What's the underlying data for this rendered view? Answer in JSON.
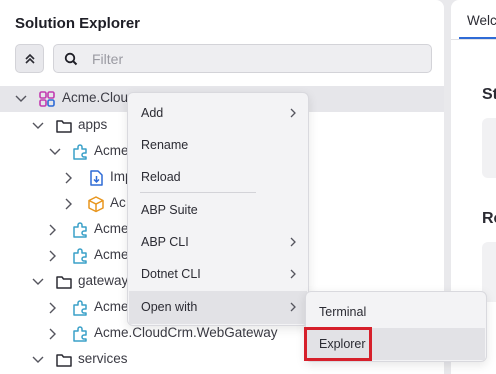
{
  "solution_explorer": {
    "title": "Solution Explorer",
    "filter_placeholder": "Filter",
    "tree": [
      {
        "label": "Acme.Clou",
        "icon": "solution-icon",
        "expanded": true
      },
      {
        "label": "apps",
        "icon": "folder-icon",
        "expanded": true
      },
      {
        "label": "Acme",
        "icon": "module-icon",
        "expanded": true
      },
      {
        "label": "Imp",
        "icon": "import-icon",
        "expanded": false
      },
      {
        "label": "Ac",
        "icon": "package-icon",
        "expanded": false
      },
      {
        "label": "Acme",
        "icon": "module-icon",
        "expanded": false
      },
      {
        "label": "Acme",
        "icon": "module-icon",
        "expanded": false
      },
      {
        "label": "gateway",
        "icon": "folder-icon",
        "expanded": true
      },
      {
        "label": "Acme",
        "icon": "module-icon",
        "expanded": false
      },
      {
        "label": "Acme.CloudCrm.WebGateway",
        "icon": "module-icon",
        "expanded": false
      },
      {
        "label": "services",
        "icon": "folder-icon",
        "expanded": true
      }
    ]
  },
  "context_menu": {
    "items": [
      {
        "label": "Add",
        "has_submenu": true
      },
      {
        "label": "Rename",
        "has_submenu": false
      },
      {
        "label": "Reload",
        "has_submenu": false
      },
      {
        "label": "ABP Suite",
        "has_submenu": false
      },
      {
        "label": "ABP CLI",
        "has_submenu": true
      },
      {
        "label": "Dotnet CLI",
        "has_submenu": true
      },
      {
        "label": "Open with",
        "has_submenu": true
      }
    ],
    "active_item": "Open with"
  },
  "open_with_submenu": {
    "items": [
      {
        "label": "Terminal"
      },
      {
        "label": "Explorer"
      }
    ],
    "highlighted_item": "Explorer"
  },
  "right_panel": {
    "tab_label": "Welc",
    "section1_heading": "St",
    "section2_heading": "Re"
  },
  "colors": {
    "accent": "#2f6bd6",
    "highlight_border": "#d6202b",
    "module_icon": "#3aa0c8",
    "solution_icon": "#c23bb0",
    "package_icon": "#e8961e"
  }
}
